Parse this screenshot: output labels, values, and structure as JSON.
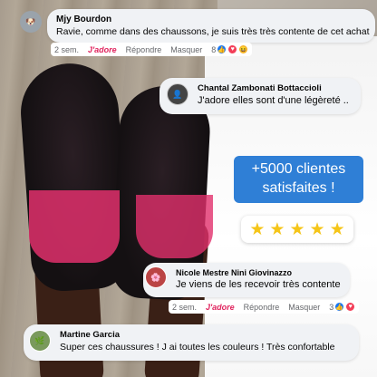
{
  "comments": [
    {
      "name": "Mjy Bourdon",
      "text": "Ravie, comme dans des chaussons, je suis très très contente de cet achat",
      "time": "2 sem.",
      "love_label": "J'adore",
      "reply_label": "Répondre",
      "hide_label": "Masquer",
      "reaction_count": "8"
    },
    {
      "name": "Chantal Zambonati Bottaccioli",
      "text": "J'adore elles sont d'une légèreté .."
    },
    {
      "name": "Nicole Mestre Nini Giovinazzo",
      "text": "Je viens de les recevoir très contente",
      "time": "2 sem.",
      "love_label": "J'adore",
      "reply_label": "Répondre",
      "hide_label": "Masquer",
      "reaction_count": "3"
    },
    {
      "name": "Martine Garcia",
      "text": "Super ces chaussures ! J ai toutes les couleurs ! Très confortable"
    }
  ],
  "promo": {
    "line1": "+5000 clientes",
    "line2": "satisfaites !"
  },
  "rating": {
    "stars": 5,
    "max": 5
  },
  "colors": {
    "promo_bg": "#2f7fd6",
    "love": "#e0245e",
    "star": "#f5c518"
  }
}
